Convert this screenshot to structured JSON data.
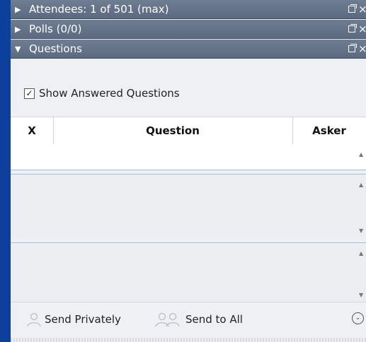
{
  "panels": [
    {
      "arrow": "▶",
      "title": "Attendees: 1 of 501 (max)"
    },
    {
      "arrow": "▶",
      "title": "Polls (0/0)"
    },
    {
      "arrow": "▼",
      "title": "Questions"
    }
  ],
  "questions": {
    "show_answered_label": "Show Answered Questions",
    "show_answered_checked": true,
    "columns": {
      "x": "X",
      "question": "Question",
      "asker": "Asker"
    }
  },
  "footer": {
    "send_privately": "Send Privately",
    "send_to_all": "Send to All"
  },
  "icons": {
    "close": "×",
    "check": "✓",
    "more": "⌄"
  },
  "colors": {
    "background": "#0d3f9c",
    "header": "#5b6a80",
    "panel": "#eef0f3"
  }
}
